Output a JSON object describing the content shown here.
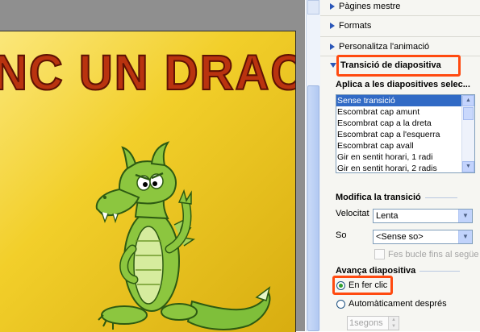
{
  "slide": {
    "title": "NC UN DRAC"
  },
  "task_pane": {
    "nav": [
      {
        "label": "Pàgines mestre"
      },
      {
        "label": "Formats"
      },
      {
        "label": "Personalitza l'animació"
      }
    ],
    "section_title": "Transició de diapositiva",
    "apply_heading": "Aplica a les diapositives selec...",
    "transitions": [
      "Sense transició",
      "Escombrat cap amunt",
      "Escombrat cap a la dreta",
      "Escombrat cap a l'esquerra",
      "Escombrat cap avall",
      "Gir en sentit horari, 1 radi",
      "Gir en sentit horari, 2 radis"
    ],
    "selected_transition": "Sense transició",
    "modify_heading": "Modifica la transició",
    "speed_label": "Velocitat",
    "speed_value": "Lenta",
    "sound_label": "So",
    "sound_value": "<Sense so>",
    "loop_label": "Fes bucle fins al següe",
    "advance_heading": "Avança diapositiva",
    "on_click_label": "En fer clic",
    "auto_label": "Automàticament després",
    "seconds_value": "1segons"
  },
  "colors": {
    "highlight": "#ff4a10",
    "slide_bg": "#f2cf2a",
    "title_color": "#b9330f",
    "accent_blue": "#2a56b8",
    "selection": "#316ac5"
  }
}
